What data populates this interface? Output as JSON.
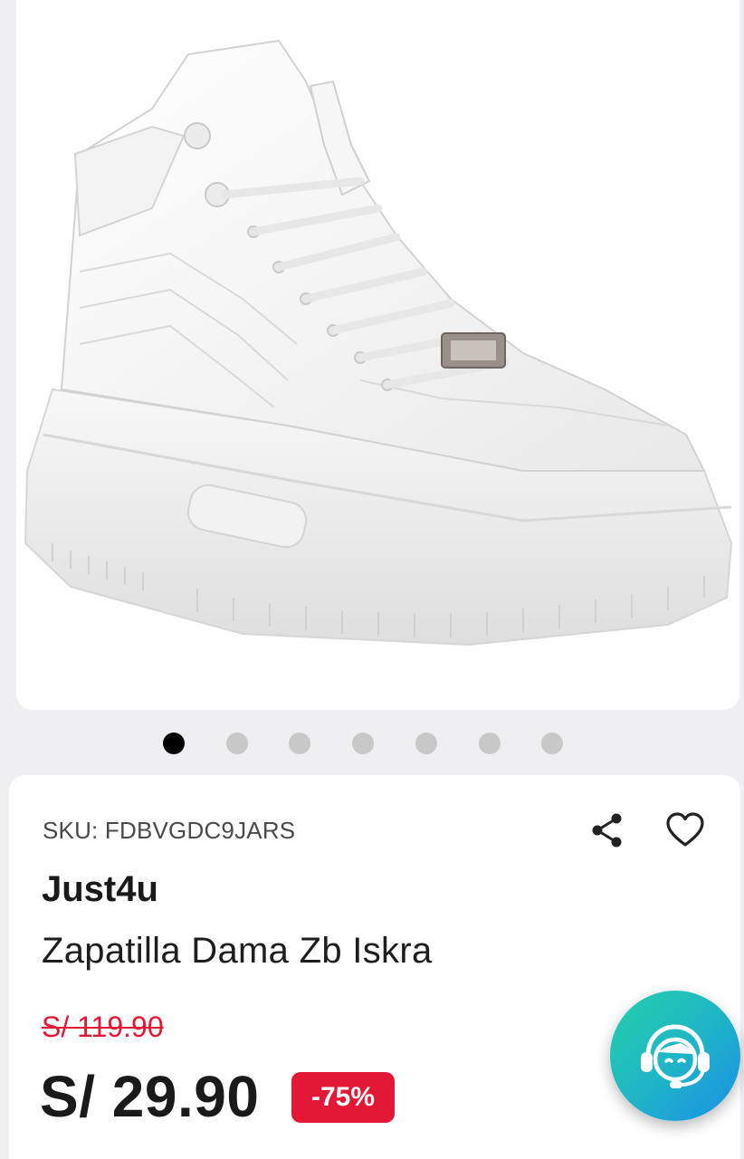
{
  "gallery": {
    "image_alt": "White high-top sneaker",
    "slide_count": 7,
    "active_index": 0,
    "icons": {
      "product": "sneaker-image"
    }
  },
  "product": {
    "sku_label": "SKU: FDBVGDC9JARS",
    "brand": "Just4u",
    "name": "Zapatilla Dama Zb Iskra",
    "old_price": "S/ 119.90",
    "price": "S/ 29.90",
    "discount": "-75%"
  },
  "actions": {
    "icons": {
      "share": "share-icon",
      "favorite": "heart-icon",
      "support": "support-agent-icon"
    }
  },
  "colors": {
    "accent_red": "#e31837",
    "dot_active": "#000000",
    "dot_inactive": "#c8c8c8",
    "fab_gradient_start": "#24d0a8",
    "fab_gradient_end": "#1b8fe6"
  }
}
